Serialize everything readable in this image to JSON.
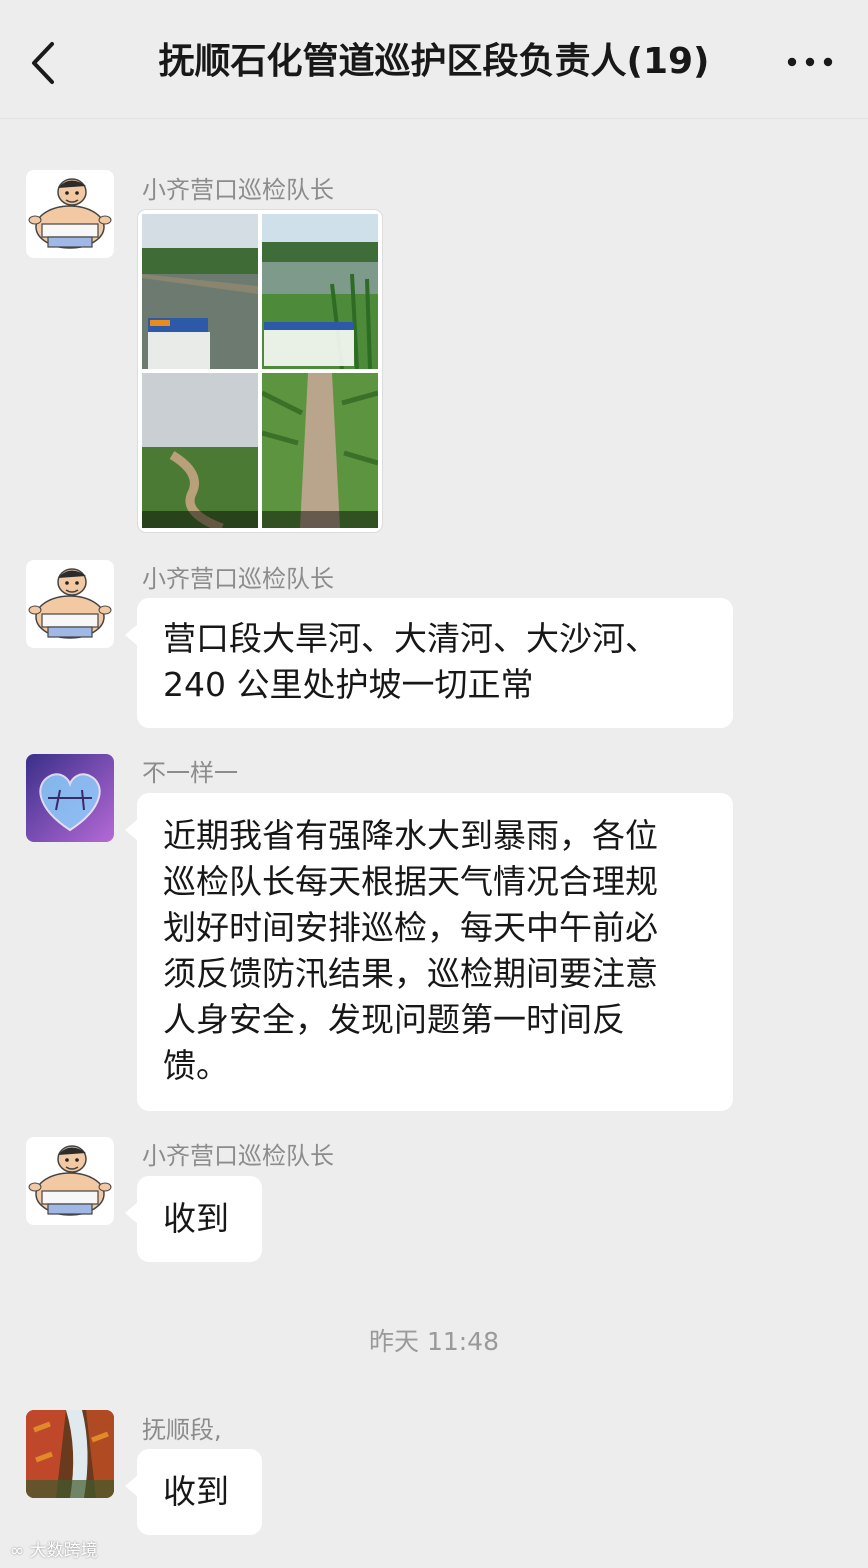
{
  "header": {
    "title": "抚顺石化管道巡护区段负责人(19)",
    "back_icon": "chevron-left-icon",
    "more_icon": "more-dots-icon"
  },
  "messages": [
    {
      "sender": "小齐营口巡检队长",
      "type": "image",
      "avatar": "cartoon-avatar"
    },
    {
      "sender": "小齐营口巡检队长",
      "type": "text",
      "lines": [
        "营口段大旱河、大清河、大沙河、",
        "240 公里处护坡一切正常"
      ],
      "avatar": "cartoon-avatar"
    },
    {
      "sender": "不一样一",
      "type": "text",
      "lines": [
        "近期我省有强降水大到暴雨，各位",
        "巡检队长每天根据天气情况合理规",
        "划好时间安排巡检，每天中午前必",
        "须反馈防汛结果，巡检期间要注意",
        "人身安全，发现问题第一时间反",
        "馈。"
      ],
      "avatar": "heart-avatar"
    },
    {
      "sender": "小齐营口巡检队长",
      "type": "text",
      "lines": [
        "收到"
      ],
      "avatar": "cartoon-avatar"
    },
    {
      "sender": "抚顺段,",
      "type": "text",
      "lines": [
        "收到"
      ],
      "avatar": "landscape-avatar"
    }
  ],
  "timestamp": "昨天 11:48",
  "watermark": "大数跨境",
  "colors": {
    "background": "#ededed",
    "bubble": "#ffffff",
    "nickname": "#8c8c8c"
  }
}
